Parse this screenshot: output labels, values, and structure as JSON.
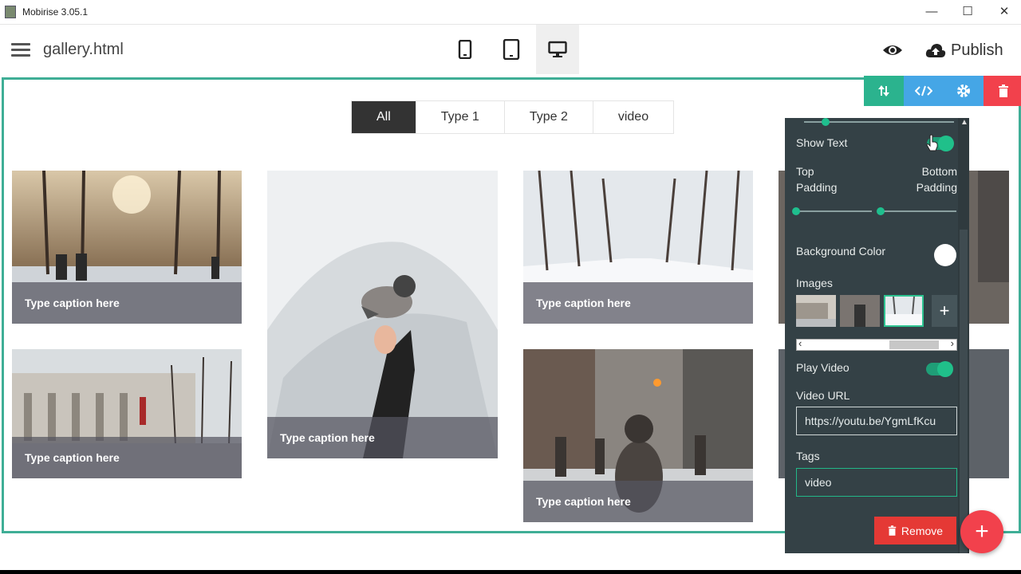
{
  "window": {
    "title": "Mobirise 3.05.1",
    "minimize_glyph": "—",
    "maximize_glyph": "☐",
    "close_glyph": "✕"
  },
  "header": {
    "filename": "gallery.html",
    "publish_label": "Publish",
    "devices": [
      "phone-icon",
      "tablet-icon",
      "desktop-icon"
    ],
    "active_device": "desktop"
  },
  "filters": [
    "All",
    "Type 1",
    "Type 2",
    "video"
  ],
  "active_filter": "All",
  "gallery": {
    "caption": "Type caption here"
  },
  "panel": {
    "show_text_label": "Show Text",
    "show_text_on": true,
    "top_padding_label": "Top Padding",
    "bottom_padding_label": "Bottom Padding",
    "top_padding_line1": "Top",
    "top_padding_line2": "Padding",
    "bottom_padding_line1": "Bottom",
    "bottom_padding_line2": "Padding",
    "background_color_label": "Background Color",
    "background_color": "#ffffff",
    "images_label": "Images",
    "add_image_glyph": "+",
    "play_video_label": "Play Video",
    "play_video_on": true,
    "video_url_label": "Video URL",
    "video_url_value": "https://youtu.be/YgmLfKcu",
    "tags_label": "Tags",
    "tags_value": "video",
    "remove_label": "Remove",
    "scroll_left": "‹",
    "scroll_right": "›"
  },
  "fab_glyph": "+",
  "colors": {
    "accent": "#3fae96",
    "panel_bg": "#344146",
    "toggle": "#20c08a",
    "remove": "#e53935",
    "fab": "#f2414c",
    "tool_move": "#2bb38e",
    "tool_code": "#45a6e6",
    "tool_gear": "#45a6e6",
    "tool_delete": "#f2414c"
  }
}
